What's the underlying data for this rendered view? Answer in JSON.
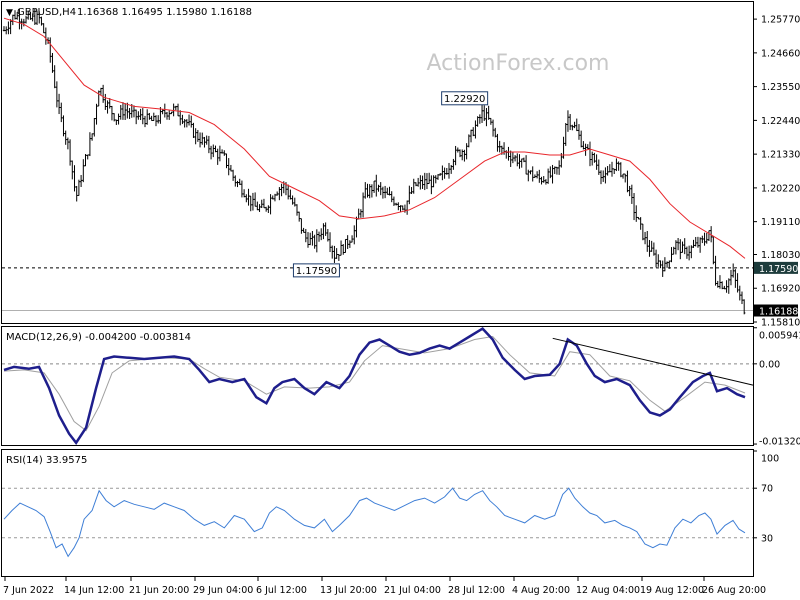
{
  "header": {
    "symbol": "GBPUSD,H4",
    "ohlc": "1.16368 1.16495 1.15980 1.16188",
    "marker": "▼"
  },
  "watermark": "ActionForex.com",
  "colors": {
    "price": "#000000",
    "ma": "#e8262b",
    "macd_main": "#1e1e8c",
    "macd_signal": "#a0a0a0",
    "rsi": "#3f7fd6",
    "frame": "#000000",
    "level_dash": "#000000",
    "current_label_bg": "#000000",
    "level_label_bg": "#1d3c3c",
    "watermark": "#c8c8c8"
  },
  "chart_data": [
    {
      "type": "candlestick",
      "title": "GBPUSD,H4",
      "series": [
        {
          "name": "GBPUSD,H4",
          "kind": "price_bars"
        },
        {
          "name": "",
          "kind": "moving_average"
        }
      ],
      "ylim": [
        1.1581,
        1.263
      ],
      "y_ticks": [
        "1.25770",
        "1.24660",
        "1.23550",
        "1.22440",
        "1.21330",
        "1.20220",
        "1.19110",
        "1.18030",
        "1.16920",
        "1.15810"
      ],
      "x_ticks": [
        "7 Jun 2022",
        "14 Jun 12:00",
        "21 Jun 20:00",
        "29 Jun 04:00",
        "6 Jul 12:00",
        "13 Jul 20:00",
        "21 Jul 04:00",
        "28 Jul 12:00",
        "4 Aug 20:00",
        "12 Aug 04:00",
        "19 Aug 12:00",
        "26 Aug 20:00"
      ],
      "price_path": [
        [
          0,
          1.254
        ],
        [
          10,
          1.259
        ],
        [
          22,
          1.2575
        ],
        [
          35,
          1.258
        ],
        [
          45,
          1.248
        ],
        [
          55,
          1.227
        ],
        [
          65,
          1.215
        ],
        [
          72,
          1.199
        ],
        [
          80,
          1.21
        ],
        [
          88,
          1.22
        ],
        [
          95,
          1.236
        ],
        [
          102,
          1.23
        ],
        [
          112,
          1.225
        ],
        [
          120,
          1.228
        ],
        [
          130,
          1.226
        ],
        [
          140,
          1.225
        ],
        [
          150,
          1.224
        ],
        [
          160,
          1.227
        ],
        [
          170,
          1.228
        ],
        [
          180,
          1.225
        ],
        [
          190,
          1.22
        ],
        [
          200,
          1.217
        ],
        [
          210,
          1.214
        ],
        [
          220,
          1.212
        ],
        [
          230,
          1.205
        ],
        [
          240,
          1.201
        ],
        [
          250,
          1.196
        ],
        [
          260,
          1.195
        ],
        [
          270,
          1.201
        ],
        [
          280,
          1.203
        ],
        [
          290,
          1.196
        ],
        [
          300,
          1.186
        ],
        [
          310,
          1.184
        ],
        [
          320,
          1.19
        ],
        [
          330,
          1.18
        ],
        [
          340,
          1.183
        ],
        [
          350,
          1.188
        ],
        [
          360,
          1.2
        ],
        [
          370,
          1.203
        ],
        [
          380,
          1.2
        ],
        [
          390,
          1.198
        ],
        [
          400,
          1.196
        ],
        [
          410,
          1.203
        ],
        [
          420,
          1.204
        ],
        [
          430,
          1.204
        ],
        [
          440,
          1.207
        ],
        [
          450,
          1.213
        ],
        [
          460,
          1.215
        ],
        [
          470,
          1.222
        ],
        [
          478,
          1.227
        ],
        [
          485,
          1.224
        ],
        [
          495,
          1.215
        ],
        [
          505,
          1.213
        ],
        [
          515,
          1.211
        ],
        [
          525,
          1.207
        ],
        [
          535,
          1.205
        ],
        [
          545,
          1.206
        ],
        [
          555,
          1.209
        ],
        [
          562,
          1.226
        ],
        [
          570,
          1.222
        ],
        [
          580,
          1.215
        ],
        [
          590,
          1.211
        ],
        [
          600,
          1.205
        ],
        [
          610,
          1.21
        ],
        [
          620,
          1.206
        ],
        [
          630,
          1.194
        ],
        [
          640,
          1.185
        ],
        [
          650,
          1.179
        ],
        [
          660,
          1.176
        ],
        [
          670,
          1.184
        ],
        [
          680,
          1.181
        ],
        [
          690,
          1.183
        ],
        [
          700,
          1.185
        ],
        [
          705,
          1.189
        ],
        [
          710,
          1.172
        ],
        [
          720,
          1.17
        ],
        [
          728,
          1.174
        ],
        [
          735,
          1.166
        ],
        [
          740,
          1.1619
        ]
      ],
      "ma_path": [
        [
          0,
          1.258
        ],
        [
          20,
          1.256
        ],
        [
          40,
          1.252
        ],
        [
          60,
          1.244
        ],
        [
          80,
          1.236
        ],
        [
          100,
          1.232
        ],
        [
          130,
          1.229
        ],
        [
          160,
          1.228
        ],
        [
          185,
          1.227
        ],
        [
          210,
          1.223
        ],
        [
          240,
          1.215
        ],
        [
          265,
          1.206
        ],
        [
          290,
          1.202
        ],
        [
          315,
          1.198
        ],
        [
          335,
          1.193
        ],
        [
          355,
          1.192
        ],
        [
          380,
          1.193
        ],
        [
          405,
          1.195
        ],
        [
          430,
          1.199
        ],
        [
          455,
          1.205
        ],
        [
          480,
          1.211
        ],
        [
          500,
          1.214
        ],
        [
          520,
          1.214
        ],
        [
          545,
          1.213
        ],
        [
          565,
          1.213
        ],
        [
          585,
          1.215
        ],
        [
          605,
          1.213
        ],
        [
          625,
          1.211
        ],
        [
          645,
          1.205
        ],
        [
          665,
          1.197
        ],
        [
          685,
          1.191
        ],
        [
          705,
          1.187
        ],
        [
          725,
          1.183
        ],
        [
          740,
          1.179
        ]
      ],
      "levels": [
        {
          "value": 1.1759,
          "label": "1.17590",
          "style": "dashed",
          "label_text": "1.17590"
        },
        {
          "value": 1.16188,
          "label": "1.16188",
          "style": "solid-gray"
        }
      ],
      "annotations": [
        {
          "text": "1.22920",
          "x_index": 478,
          "value": 1.2292
        },
        {
          "text": "1.17590",
          "x_index": 330,
          "value": 1.1759
        }
      ],
      "current_price_label": "1.16188",
      "level_price_label": "1.17590"
    },
    {
      "type": "line",
      "title": "MACD(12,26,9) -0.004200 -0.003814",
      "series": [
        {
          "name": "MACD(12,26,9)",
          "kind": "macd_main"
        },
        {
          "name": "",
          "kind": "macd_signal"
        }
      ],
      "ylim": [
        -0.0132,
        0.0059
      ],
      "y_ticks": [
        "0.005941",
        "0.00",
        "-0.013207"
      ],
      "main_path": [
        [
          0,
          -0.001
        ],
        [
          10,
          -0.0005
        ],
        [
          25,
          -0.0008
        ],
        [
          35,
          -0.0005
        ],
        [
          45,
          -0.004
        ],
        [
          55,
          -0.0085
        ],
        [
          65,
          -0.0115
        ],
        [
          72,
          -0.013
        ],
        [
          82,
          -0.0105
        ],
        [
          92,
          -0.004
        ],
        [
          100,
          0.0008
        ],
        [
          110,
          0.0012
        ],
        [
          125,
          0.001
        ],
        [
          140,
          0.0008
        ],
        [
          155,
          0.001
        ],
        [
          170,
          0.0012
        ],
        [
          185,
          0.0008
        ],
        [
          195,
          -0.001
        ],
        [
          205,
          -0.003
        ],
        [
          215,
          -0.0025
        ],
        [
          228,
          -0.003
        ],
        [
          240,
          -0.0025
        ],
        [
          252,
          -0.0055
        ],
        [
          262,
          -0.0065
        ],
        [
          270,
          -0.004
        ],
        [
          278,
          -0.003
        ],
        [
          290,
          -0.0025
        ],
        [
          300,
          -0.004
        ],
        [
          310,
          -0.005
        ],
        [
          322,
          -0.003
        ],
        [
          335,
          -0.004
        ],
        [
          345,
          -0.002
        ],
        [
          355,
          0.0015
        ],
        [
          365,
          0.0035
        ],
        [
          375,
          0.004
        ],
        [
          385,
          0.003
        ],
        [
          395,
          0.002
        ],
        [
          405,
          0.0015
        ],
        [
          415,
          0.0018
        ],
        [
          425,
          0.0025
        ],
        [
          435,
          0.003
        ],
        [
          445,
          0.0025
        ],
        [
          455,
          0.0035
        ],
        [
          465,
          0.0045
        ],
        [
          478,
          0.0058
        ],
        [
          488,
          0.004
        ],
        [
          498,
          0.001
        ],
        [
          510,
          -0.001
        ],
        [
          520,
          -0.0025
        ],
        [
          530,
          -0.002
        ],
        [
          545,
          -0.0018
        ],
        [
          555,
          0.0
        ],
        [
          563,
          0.004
        ],
        [
          572,
          0.003
        ],
        [
          582,
          0.0
        ],
        [
          590,
          -0.002
        ],
        [
          600,
          -0.003
        ],
        [
          612,
          -0.0025
        ],
        [
          625,
          -0.0035
        ],
        [
          635,
          -0.006
        ],
        [
          645,
          -0.008
        ],
        [
          655,
          -0.0085
        ],
        [
          665,
          -0.0075
        ],
        [
          675,
          -0.0055
        ],
        [
          688,
          -0.003
        ],
        [
          698,
          -0.002
        ],
        [
          705,
          -0.0015
        ],
        [
          712,
          -0.0045
        ],
        [
          722,
          -0.004
        ],
        [
          732,
          -0.005
        ],
        [
          740,
          -0.0055
        ]
      ],
      "signal_path": [
        [
          0,
          -0.0012
        ],
        [
          20,
          -0.001
        ],
        [
          40,
          -0.0015
        ],
        [
          55,
          -0.005
        ],
        [
          70,
          -0.0095
        ],
        [
          82,
          -0.011
        ],
        [
          95,
          -0.007
        ],
        [
          108,
          -0.0015
        ],
        [
          125,
          0.0005
        ],
        [
          160,
          0.001
        ],
        [
          185,
          0.0008
        ],
        [
          200,
          -0.0008
        ],
        [
          215,
          -0.0022
        ],
        [
          240,
          -0.0028
        ],
        [
          262,
          -0.005
        ],
        [
          280,
          -0.0038
        ],
        [
          305,
          -0.004
        ],
        [
          325,
          -0.0038
        ],
        [
          345,
          -0.003
        ],
        [
          360,
          0.0005
        ],
        [
          378,
          0.003
        ],
        [
          395,
          0.0025
        ],
        [
          420,
          0.0018
        ],
        [
          445,
          0.0025
        ],
        [
          470,
          0.004
        ],
        [
          488,
          0.0045
        ],
        [
          505,
          0.0015
        ],
        [
          525,
          -0.0015
        ],
        [
          550,
          -0.002
        ],
        [
          565,
          0.002
        ],
        [
          585,
          0.0015
        ],
        [
          605,
          -0.002
        ],
        [
          625,
          -0.0028
        ],
        [
          645,
          -0.006
        ],
        [
          660,
          -0.0078
        ],
        [
          680,
          -0.0055
        ],
        [
          700,
          -0.003
        ],
        [
          720,
          -0.0035
        ],
        [
          740,
          -0.0048
        ]
      ],
      "trendline": {
        "from": [
          548,
          0.0042
        ],
        "to": [
          755,
          -0.0035
        ]
      }
    },
    {
      "type": "line",
      "title": "RSI(14) 33.9575",
      "series": [
        {
          "name": "RSI(14)",
          "kind": "rsi"
        }
      ],
      "ylim": [
        0,
        100
      ],
      "y_ticks": [
        "100",
        "70",
        "30",
        "0"
      ],
      "levels": [
        70,
        30
      ],
      "rsi_path": [
        [
          0,
          45
        ],
        [
          8,
          52
        ],
        [
          16,
          58
        ],
        [
          24,
          55
        ],
        [
          32,
          52
        ],
        [
          40,
          47
        ],
        [
          46,
          35
        ],
        [
          52,
          22
        ],
        [
          58,
          25
        ],
        [
          64,
          15
        ],
        [
          70,
          22
        ],
        [
          75,
          30
        ],
        [
          80,
          45
        ],
        [
          88,
          52
        ],
        [
          95,
          68
        ],
        [
          102,
          60
        ],
        [
          110,
          55
        ],
        [
          120,
          60
        ],
        [
          130,
          57
        ],
        [
          140,
          55
        ],
        [
          150,
          53
        ],
        [
          160,
          58
        ],
        [
          170,
          55
        ],
        [
          180,
          52
        ],
        [
          190,
          45
        ],
        [
          200,
          40
        ],
        [
          210,
          43
        ],
        [
          220,
          38
        ],
        [
          230,
          48
        ],
        [
          240,
          45
        ],
        [
          250,
          35
        ],
        [
          258,
          38
        ],
        [
          265,
          50
        ],
        [
          272,
          55
        ],
        [
          280,
          52
        ],
        [
          290,
          45
        ],
        [
          300,
          40
        ],
        [
          310,
          38
        ],
        [
          320,
          45
        ],
        [
          328,
          35
        ],
        [
          335,
          40
        ],
        [
          345,
          48
        ],
        [
          355,
          60
        ],
        [
          362,
          62
        ],
        [
          370,
          58
        ],
        [
          380,
          55
        ],
        [
          390,
          52
        ],
        [
          400,
          56
        ],
        [
          410,
          60
        ],
        [
          420,
          62
        ],
        [
          430,
          58
        ],
        [
          440,
          63
        ],
        [
          448,
          70
        ],
        [
          455,
          62
        ],
        [
          462,
          60
        ],
        [
          470,
          65
        ],
        [
          478,
          68
        ],
        [
          485,
          60
        ],
        [
          492,
          55
        ],
        [
          500,
          48
        ],
        [
          510,
          45
        ],
        [
          520,
          42
        ],
        [
          530,
          48
        ],
        [
          540,
          45
        ],
        [
          550,
          48
        ],
        [
          558,
          65
        ],
        [
          564,
          70
        ],
        [
          570,
          62
        ],
        [
          578,
          55
        ],
        [
          585,
          50
        ],
        [
          592,
          48
        ],
        [
          600,
          42
        ],
        [
          610,
          44
        ],
        [
          618,
          40
        ],
        [
          625,
          38
        ],
        [
          632,
          35
        ],
        [
          640,
          25
        ],
        [
          648,
          22
        ],
        [
          655,
          25
        ],
        [
          662,
          24
        ],
        [
          670,
          38
        ],
        [
          678,
          45
        ],
        [
          686,
          42
        ],
        [
          694,
          48
        ],
        [
          700,
          50
        ],
        [
          706,
          45
        ],
        [
          712,
          33
        ],
        [
          720,
          40
        ],
        [
          728,
          44
        ],
        [
          734,
          37
        ],
        [
          740,
          34
        ]
      ]
    }
  ],
  "x_axis_labels": [
    "7 Jun 2022",
    "14 Jun 12:00",
    "21 Jun 20:00",
    "29 Jun 04:00",
    "6 Jul 12:00",
    "13 Jul 20:00",
    "21 Jul 04:00",
    "28 Jul 12:00",
    "4 Aug 20:00",
    "12 Aug 04:00",
    "19 Aug 12:00",
    "26 Aug 20:00"
  ]
}
